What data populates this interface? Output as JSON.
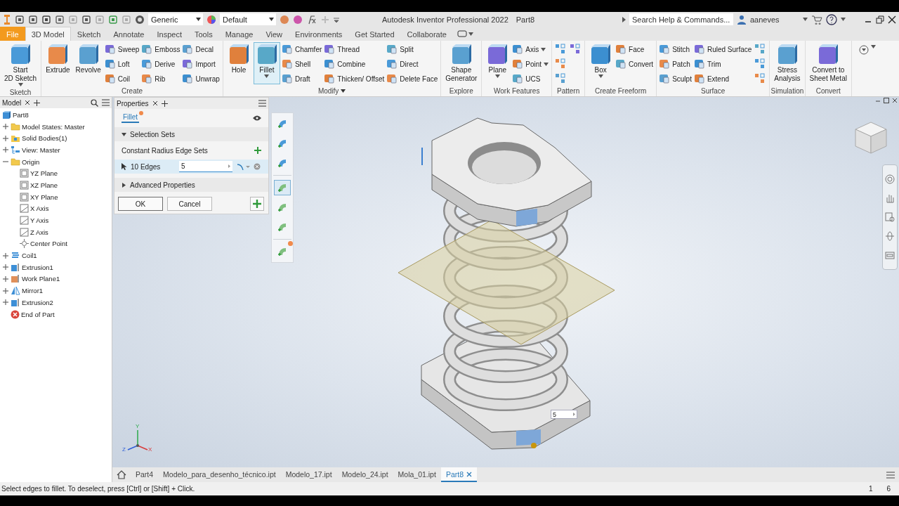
{
  "title_bar": {
    "material": "Generic",
    "appearance": "Default",
    "app_title": "Autodesk Inventor Professional 2022",
    "document": "Part8",
    "search_placeholder": "Search Help & Commands...",
    "user": "aaneves"
  },
  "ribbon_tabs": [
    {
      "label": "File",
      "kind": "file",
      "selected": false
    },
    {
      "label": "3D Model",
      "kind": "tab",
      "selected": true
    },
    {
      "label": "Sketch",
      "kind": "tab",
      "selected": false
    },
    {
      "label": "Annotate",
      "kind": "tab",
      "selected": false
    },
    {
      "label": "Inspect",
      "kind": "tab",
      "selected": false
    },
    {
      "label": "Tools",
      "kind": "tab",
      "selected": false
    },
    {
      "label": "Manage",
      "kind": "tab",
      "selected": false
    },
    {
      "label": "View",
      "kind": "tab",
      "selected": false
    },
    {
      "label": "Environments",
      "kind": "tab",
      "selected": false
    },
    {
      "label": "Get Started",
      "kind": "tab",
      "selected": false
    },
    {
      "label": "Collaborate",
      "kind": "tab",
      "selected": false
    }
  ],
  "ribbon_panels": [
    {
      "title": "Sketch",
      "title_menu": false,
      "groups": [
        {
          "kind": "large",
          "label_lines": [
            "Start",
            "2D Sketch"
          ],
          "selected": false,
          "dropdown": true
        }
      ]
    },
    {
      "title": "Create",
      "title_menu": false,
      "groups": [
        {
          "kind": "large",
          "label_lines": [
            "Extrude"
          ],
          "selected": false,
          "dropdown": false
        },
        {
          "kind": "large",
          "label_lines": [
            "Revolve"
          ],
          "selected": false,
          "dropdown": false
        },
        {
          "kind": "column",
          "tools": [
            {
              "kind": "labeled",
              "label": "Sweep",
              "dropdown": false
            },
            {
              "kind": "labeled",
              "label": "Loft",
              "dropdown": false
            },
            {
              "kind": "labeled",
              "label": "Coil",
              "dropdown": false
            }
          ]
        },
        {
          "kind": "column",
          "tools": [
            {
              "kind": "labeled",
              "label": "Emboss",
              "dropdown": false
            },
            {
              "kind": "labeled",
              "label": "Derive",
              "dropdown": false
            },
            {
              "kind": "labeled",
              "label": "Rib",
              "dropdown": false
            }
          ]
        },
        {
          "kind": "column",
          "tools": [
            {
              "kind": "labeled",
              "label": "Decal",
              "dropdown": false
            },
            {
              "kind": "labeled",
              "label": "Import",
              "dropdown": false
            },
            {
              "kind": "labeled",
              "label": "Unwrap",
              "dropdown": false
            }
          ]
        }
      ]
    },
    {
      "title": "Modify",
      "title_menu": true,
      "groups": [
        {
          "kind": "large",
          "label_lines": [
            "Hole"
          ],
          "selected": false,
          "dropdown": false
        },
        {
          "kind": "large",
          "label_lines": [
            "Fillet"
          ],
          "selected": true,
          "dropdown": true
        },
        {
          "kind": "column",
          "tools": [
            {
              "kind": "labeled",
              "label": "Chamfer",
              "dropdown": false
            },
            {
              "kind": "labeled",
              "label": "Shell",
              "dropdown": false
            },
            {
              "kind": "labeled",
              "label": "Draft",
              "dropdown": false
            }
          ]
        },
        {
          "kind": "column",
          "tools": [
            {
              "kind": "labeled",
              "label": "Thread",
              "dropdown": false
            },
            {
              "kind": "labeled",
              "label": "Combine",
              "dropdown": false
            },
            {
              "kind": "labeled",
              "label": "Thicken/ Offset",
              "dropdown": false
            }
          ]
        },
        {
          "kind": "column",
          "tools": [
            {
              "kind": "labeled",
              "label": "Split",
              "dropdown": false
            },
            {
              "kind": "labeled",
              "label": "Direct",
              "dropdown": false
            },
            {
              "kind": "labeled",
              "label": "Delete Face",
              "dropdown": false
            }
          ]
        }
      ]
    },
    {
      "title": "Explore",
      "title_menu": false,
      "groups": [
        {
          "kind": "large",
          "label_lines": [
            "Shape",
            "Generator"
          ],
          "selected": false,
          "dropdown": false
        }
      ]
    },
    {
      "title": "Work Features",
      "title_menu": false,
      "groups": [
        {
          "kind": "large",
          "label_lines": [
            "Plane"
          ],
          "selected": false,
          "dropdown": true
        },
        {
          "kind": "column",
          "tools": [
            {
              "kind": "labeled",
              "label": "Axis",
              "dropdown": true
            },
            {
              "kind": "labeled",
              "label": "Point",
              "dropdown": true
            },
            {
              "kind": "labeled",
              "label": "UCS",
              "dropdown": false
            }
          ]
        }
      ]
    },
    {
      "title": "Pattern",
      "title_menu": false,
      "groups": [
        {
          "kind": "column",
          "tools": [
            {
              "kind": "icon"
            },
            {
              "kind": "icon"
            },
            {
              "kind": "icon"
            }
          ]
        },
        {
          "kind": "column",
          "tools": [
            {
              "kind": "icon"
            }
          ]
        }
      ]
    },
    {
      "title": "Create Freeform",
      "title_menu": false,
      "groups": [
        {
          "kind": "large",
          "label_lines": [
            "Box"
          ],
          "selected": false,
          "dropdown": true
        },
        {
          "kind": "column",
          "tools": [
            {
              "kind": "labeled",
              "label": "Face",
              "dropdown": false
            },
            {
              "kind": "labeled",
              "label": "Convert",
              "dropdown": false
            }
          ]
        }
      ]
    },
    {
      "title": "Surface",
      "title_menu": false,
      "groups": [
        {
          "kind": "column",
          "tools": [
            {
              "kind": "labeled",
              "label": "Stitch",
              "dropdown": false
            },
            {
              "kind": "labeled",
              "label": "Patch",
              "dropdown": false
            },
            {
              "kind": "labeled",
              "label": "Sculpt",
              "dropdown": false
            }
          ]
        },
        {
          "kind": "column",
          "tools": [
            {
              "kind": "labeled",
              "label": "Ruled Surface",
              "dropdown": false
            },
            {
              "kind": "labeled",
              "label": "Trim",
              "dropdown": false
            },
            {
              "kind": "labeled",
              "label": "Extend",
              "dropdown": false
            }
          ]
        },
        {
          "kind": "column",
          "tools": [
            {
              "kind": "icon"
            },
            {
              "kind": "icon"
            },
            {
              "kind": "icon"
            }
          ]
        }
      ]
    },
    {
      "title": "Simulation",
      "title_menu": false,
      "groups": [
        {
          "kind": "large",
          "label_lines": [
            "Stress",
            "Analysis"
          ],
          "selected": false,
          "dropdown": false
        }
      ]
    },
    {
      "title": "Convert",
      "title_menu": false,
      "groups": [
        {
          "kind": "large",
          "label_lines": [
            "Convert to",
            "Sheet Metal"
          ],
          "selected": false,
          "dropdown": false
        }
      ]
    }
  ],
  "browser": {
    "tab": "Model",
    "tree": [
      {
        "label": "Part8",
        "kind": "part",
        "children": [
          {
            "label": "Model States: Master",
            "kind": "folder",
            "expanded": false
          },
          {
            "label": "Solid Bodies(1)",
            "kind": "bodies",
            "expanded": false
          },
          {
            "label": "View: Master",
            "kind": "view",
            "expanded": false
          },
          {
            "label": "Origin",
            "kind": "folder",
            "expanded": true,
            "children": [
              {
                "label": "YZ Plane",
                "kind": "plane"
              },
              {
                "label": "XZ Plane",
                "kind": "plane"
              },
              {
                "label": "XY Plane",
                "kind": "plane"
              },
              {
                "label": "X Axis",
                "kind": "axis"
              },
              {
                "label": "Y Axis",
                "kind": "axis"
              },
              {
                "label": "Z Axis",
                "kind": "axis"
              },
              {
                "label": "Center Point",
                "kind": "point"
              }
            ]
          },
          {
            "label": "Coil1",
            "kind": "coil",
            "expanded": false
          },
          {
            "label": "Extrusion1",
            "kind": "extrusion",
            "expanded": false
          },
          {
            "label": "Work Plane1",
            "kind": "workplane",
            "expanded": false
          },
          {
            "label": "Mirror1",
            "kind": "mirror",
            "expanded": false
          },
          {
            "label": "Extrusion2",
            "kind": "extrusion",
            "expanded": false
          },
          {
            "label": "End of Part",
            "kind": "end"
          }
        ]
      }
    ]
  },
  "properties": {
    "tab": "Properties",
    "command_tab": "Fillet",
    "selection_sets": {
      "label": "Selection Sets",
      "expanded": true
    },
    "edge_sets_label": "Constant Radius Edge Sets",
    "edge_set": {
      "label": "10 Edges",
      "radius": "5",
      "selected": true
    },
    "advanced": {
      "label": "Advanced Properties",
      "expanded": false
    },
    "buttons": [
      "OK",
      "Cancel"
    ]
  },
  "tool_strip": [
    {
      "selected": false,
      "alert": false
    },
    {
      "selected": false,
      "alert": false
    },
    {
      "selected": false,
      "alert": false
    },
    {
      "selected": true,
      "alert": false
    },
    {
      "selected": false,
      "alert": false
    },
    {
      "selected": false,
      "alert": false
    },
    {
      "selected": false,
      "alert": true
    }
  ],
  "viewport": {
    "dimension_value": "5",
    "triad_labels": [
      "Y",
      "Z",
      "X"
    ]
  },
  "document_tabs": [
    {
      "label": "Part4",
      "selected": false
    },
    {
      "label": "Modelo_para_desenho_técnico.ipt",
      "selected": false
    },
    {
      "label": "Modelo_17.ipt",
      "selected": false
    },
    {
      "label": "Modelo_24.ipt",
      "selected": false
    },
    {
      "label": "Mola_01.ipt",
      "selected": false
    },
    {
      "label": "Part8",
      "selected": true
    }
  ],
  "status_bar": {
    "message": "Select edges to fillet. To deselect, press [Ctrl] or [Shift] + Click.",
    "counters": [
      "1",
      "6"
    ]
  }
}
